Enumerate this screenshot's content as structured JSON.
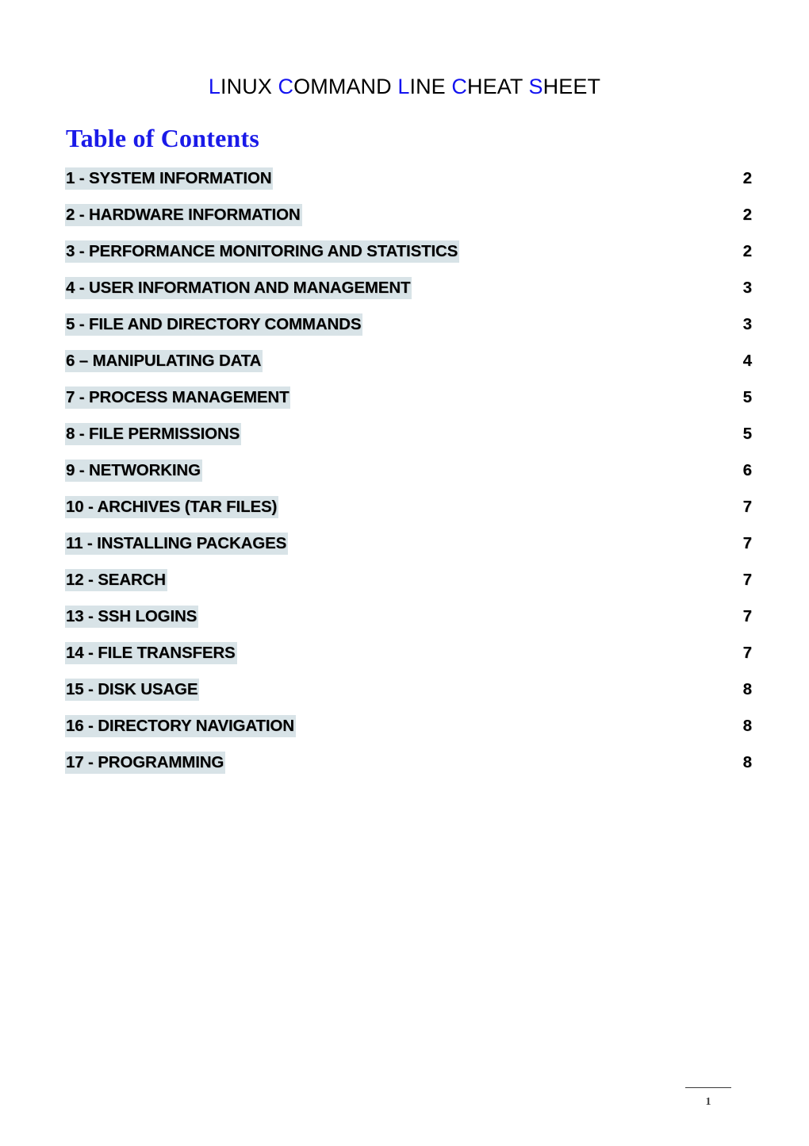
{
  "document": {
    "title_segments": [
      {
        "cap": "L",
        "rest": "INUX "
      },
      {
        "cap": "C",
        "rest": "OMMAND "
      },
      {
        "cap": "L",
        "rest": "INE "
      },
      {
        "cap": "C",
        "rest": "HEAT "
      },
      {
        "cap": "S",
        "rest": "HEET"
      }
    ],
    "title_plain": "LINUX COMMAND LINE CHEAT SHEET",
    "toc_heading": "Table of Contents",
    "accent_color": "#1313f0",
    "heading_color": "#1a1ae8",
    "highlight_color": "#d8e3e7"
  },
  "toc": {
    "entries": [
      {
        "label": "1 - SYSTEM INFORMATION",
        "page": "2"
      },
      {
        "label": "2 - HARDWARE INFORMATION",
        "page": "2"
      },
      {
        "label": "3 - PERFORMANCE MONITORING AND STATISTICS",
        "page": "2"
      },
      {
        "label": "4 - USER INFORMATION AND MANAGEMENT",
        "page": "3"
      },
      {
        "label": "5 - FILE AND DIRECTORY COMMANDS",
        "page": "3"
      },
      {
        "label": "6 – MANIPULATING DATA",
        "page": "4"
      },
      {
        "label": "7 - PROCESS MANAGEMENT",
        "page": "5"
      },
      {
        "label": "8 - FILE PERMISSIONS",
        "page": "5"
      },
      {
        "label": "9 - NETWORKING",
        "page": "6"
      },
      {
        "label": "10 - ARCHIVES (TAR FILES)",
        "page": "7"
      },
      {
        "label": "11 - INSTALLING PACKAGES",
        "page": "7"
      },
      {
        "label": "12 - SEARCH",
        "page": "7"
      },
      {
        "label": "13 - SSH LOGINS",
        "page": "7"
      },
      {
        "label": "14 - FILE TRANSFERS",
        "page": "7"
      },
      {
        "label": "15 - DISK USAGE",
        "page": "8"
      },
      {
        "label": "16 - DIRECTORY NAVIGATION",
        "page": "8"
      },
      {
        "label": "17 - PROGRAMMING",
        "page": "8"
      }
    ]
  },
  "footer": {
    "page_number": "1"
  }
}
